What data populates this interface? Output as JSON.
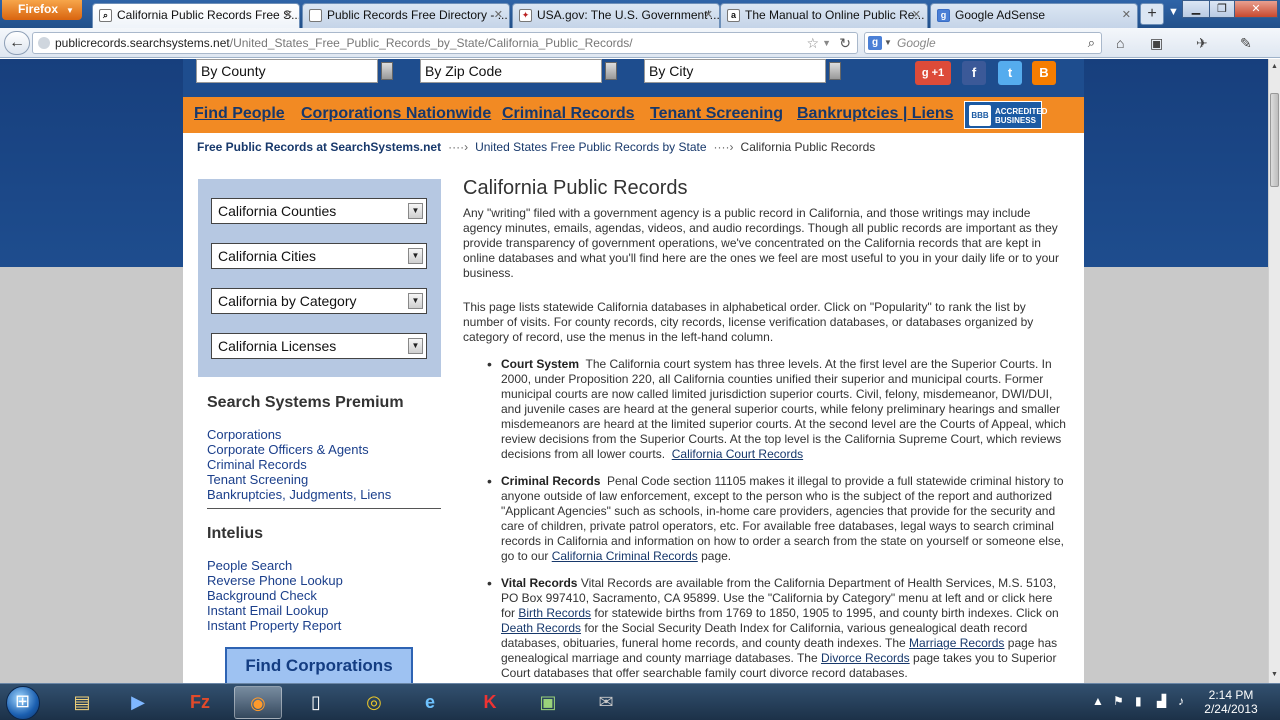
{
  "browser": {
    "menu_button": "Firefox",
    "tabs": [
      {
        "title": "California Public Records Free S...",
        "favicon": "search-favicon",
        "active": true
      },
      {
        "title": "Public Records Free Directory - ...",
        "favicon": "page-favicon",
        "active": false
      },
      {
        "title": "USA.gov: The U.S. Government'...",
        "favicon": "usagov-favicon",
        "active": false
      },
      {
        "title": "The Manual to Online Public Re...",
        "favicon": "amazon-favicon",
        "active": false
      },
      {
        "title": "Google AdSense",
        "favicon": "google-favicon",
        "active": false
      }
    ],
    "new_tab": "+",
    "url_host": "publicrecords.searchsystems.net",
    "url_path": "/United_States_Free_Public_Records_by_State/California_Public_Records/",
    "search_placeholder": "Google"
  },
  "page": {
    "top_dropdowns": [
      "By County",
      "By Zip Code",
      "By City"
    ],
    "social": [
      {
        "name": "google-plus-icon",
        "label": "g +1",
        "color": "#dd4b39"
      },
      {
        "name": "facebook-icon",
        "label": "f",
        "color": "#3b5998"
      },
      {
        "name": "twitter-icon",
        "label": "t",
        "color": "#55acee"
      },
      {
        "name": "blogger-icon",
        "label": "B",
        "color": "#f57d00"
      }
    ],
    "nav": [
      "Find People",
      "Corporations Nationwide",
      "Criminal Records",
      "Tenant Screening",
      "Bankruptcies | Liens"
    ],
    "bbb_seal": "BBB",
    "bbb_text": "ACCREDITED BUSINESS",
    "breadcrumb": {
      "home": "Free Public Records at SearchSystems.net",
      "sep": "····›",
      "level2": "United States Free Public Records by State",
      "current": "California Public Records"
    },
    "left_selects": [
      "California Counties",
      "California Cities",
      "California by Category",
      "California Licenses"
    ],
    "premium": {
      "heading": "Search Systems Premium",
      "links": [
        "Corporations",
        "Corporate Officers & Agents",
        "Criminal Records",
        "Tenant Screening",
        "Bankruptcies, Judgments, Liens"
      ]
    },
    "intelius": {
      "heading": "Intelius",
      "links": [
        "People Search",
        "Reverse Phone Lookup",
        "Background Check",
        "Instant Email Lookup",
        "Instant Property Report"
      ]
    },
    "find_corp_button": "Find Corporations Nationwide",
    "main": {
      "title": "California Public Records",
      "intro": "Any \"writing\" filed with a government agency is a public record in California, and those writings may include agency minutes, emails, agendas, videos, and audio recordings. Though all public records are important as they provide transparency of government operations, we've concentrated on the California records that are kept in online databases and what you'll find here are the ones we feel are most useful to you in your daily life or to your business.",
      "intro2": "This page lists statewide California databases in alphabetical order.  Click on \"Popularity\" to rank the list by number of visits. For county records, city records, license verification databases, or databases organized by category of record, use the menus in the left-hand column.",
      "court": {
        "label": "Court System",
        "text": "The California court system has three levels. At the first level are the Superior Courts. In 2000, under Proposition 220, all California counties unified their superior and municipal courts. Former municipal courts are now called limited jurisdiction superior courts. Civil, felony, misdemeanor, DWI/DUI, and juvenile cases are heard at the general superior courts, while felony preliminary hearings and smaller misdemeanors are heard at the limited superior courts. At the second level are the Courts of Appeal, which review decisions from the Superior Courts. At the top level is the California Supreme Court, which reviews decisions from all lower courts.",
        "link": "California Court Records"
      },
      "criminal": {
        "label": "Criminal Records",
        "text": "Penal Code section 11105 makes it illegal to provide a full statewide criminal history to anyone outside of law enforcement, except to the person who is the subject of the report and authorized \"Applicant Agencies\" such as schools, in-home care providers, agencies that provide for the security and care of children, private patrol operators, etc.  For available free databases, legal ways to search criminal records in California and information on how to order a search from the state on yourself or someone else, go to our",
        "link": "California Criminal Records",
        "tail": "page."
      },
      "vital": {
        "label": "Vital Records",
        "t1": "Vital Records are available from the California Department of Health Services, M.S. 5103, PO Box 997410, Sacramento, CA 95899. Use the \"California by Category\" menu at left and or click here for",
        "l1": "Birth Records",
        "t2": "for statewide births from 1769 to 1850, 1905 to 1995, and county birth indexes. Click on",
        "l2": "Death Records",
        "t3": "for the Social Security Death Index for California, various genealogical death record databases, obituaries, funeral home records, and county death indexes. The",
        "l3": "Marriage Records",
        "t4": "page has genealogical marriage and county marriage databases. The",
        "l4": "Divorce Records",
        "t5": "page takes you to Superior Court databases that offer searchable family court divorce record databases."
      }
    }
  },
  "taskbar": {
    "time": "2:14 PM",
    "date": "2/24/2013"
  }
}
